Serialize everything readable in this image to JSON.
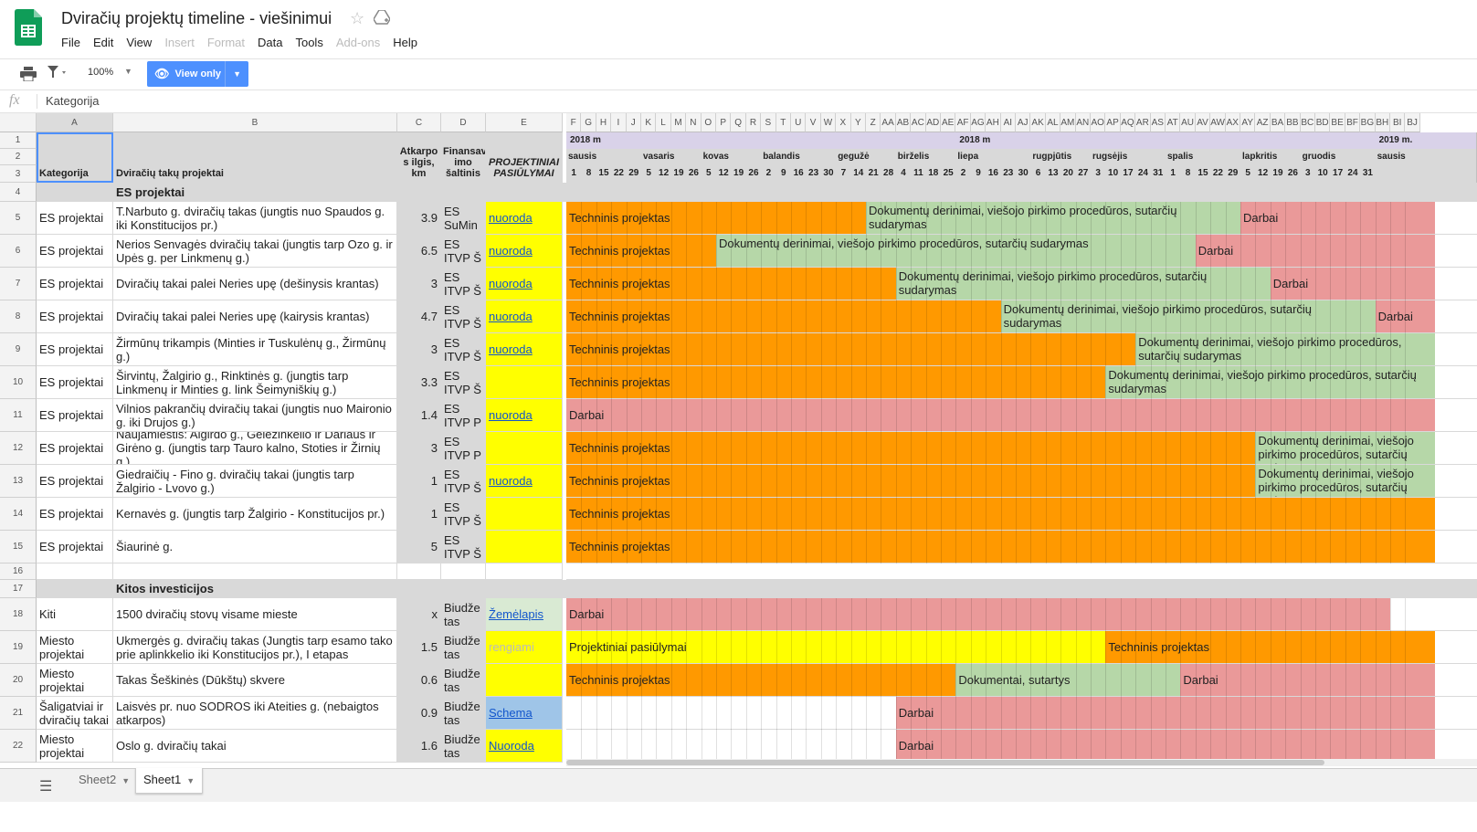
{
  "app": {
    "title": "Dviračių projektų timeline - viešinimui",
    "menu": [
      {
        "label": "File",
        "enabled": true
      },
      {
        "label": "Edit",
        "enabled": true
      },
      {
        "label": "View",
        "enabled": true
      },
      {
        "label": "Insert",
        "enabled": false
      },
      {
        "label": "Format",
        "enabled": false
      },
      {
        "label": "Data",
        "enabled": true
      },
      {
        "label": "Tools",
        "enabled": true
      },
      {
        "label": "Add-ons",
        "enabled": false
      },
      {
        "label": "Help",
        "enabled": true
      }
    ]
  },
  "toolbar": {
    "zoom": "100%",
    "view_only_label": "View only"
  },
  "formula_bar": {
    "fx": "fx",
    "content": "Kategorija"
  },
  "columns": {
    "fixed": [
      "A",
      "B",
      "C",
      "D",
      "E"
    ],
    "timeline": [
      "F",
      "G",
      "H",
      "I",
      "J",
      "K",
      "L",
      "M",
      "N",
      "O",
      "P",
      "Q",
      "R",
      "S",
      "T",
      "U",
      "V",
      "W",
      "X",
      "Y",
      "Z",
      "AA",
      "AB",
      "AC",
      "AD",
      "AE",
      "AF",
      "AG",
      "AH",
      "AI",
      "AJ",
      "AK",
      "AL",
      "AM",
      "AN",
      "AO",
      "AP",
      "AQ",
      "AR",
      "AS",
      "AT",
      "AU",
      "AV",
      "AW",
      "AX",
      "AY",
      "AZ",
      "BA",
      "BB",
      "BC",
      "BD",
      "BE",
      "BF",
      "BG",
      "BH",
      "BI",
      "BJ"
    ]
  },
  "header": {
    "kategorija": "Kategorija",
    "projektai": "Dviračių takų projektai",
    "ilgis": "Atkarpo s ilgis, km",
    "finansavimas": "Finansav imo šaltinis",
    "pasiulymai": "PROJEKTINIAI PASIŪLYMAI"
  },
  "timeline": {
    "years": [
      {
        "label": "2018 m",
        "col": 0
      },
      {
        "label": "2018 m",
        "col": 26
      },
      {
        "label": "2019 m.",
        "col": 54
      }
    ],
    "months": [
      {
        "label": "sausis",
        "col": 0
      },
      {
        "label": "vasaris",
        "col": 5
      },
      {
        "label": "kovas",
        "col": 9
      },
      {
        "label": "balandis",
        "col": 13
      },
      {
        "label": "gegužė",
        "col": 18
      },
      {
        "label": "birželis",
        "col": 22
      },
      {
        "label": "liepa",
        "col": 26
      },
      {
        "label": "rugpjūtis",
        "col": 31
      },
      {
        "label": "rugsėjis",
        "col": 35
      },
      {
        "label": "spalis",
        "col": 40
      },
      {
        "label": "lapkritis",
        "col": 45
      },
      {
        "label": "gruodis",
        "col": 49
      },
      {
        "label": "sausis",
        "col": 54
      }
    ],
    "days": [
      "1",
      "8",
      "15",
      "22",
      "29",
      "5",
      "12",
      "19",
      "26",
      "5",
      "12",
      "19",
      "26",
      "2",
      "9",
      "16",
      "23",
      "30",
      "7",
      "14",
      "21",
      "28",
      "4",
      "11",
      "18",
      "25",
      "2",
      "9",
      "16",
      "23",
      "30",
      "6",
      "13",
      "20",
      "27",
      "3",
      "10",
      "17",
      "24",
      "31",
      "1",
      "8",
      "15",
      "22",
      "29",
      "5",
      "12",
      "19",
      "26",
      "3",
      "10",
      "17",
      "24",
      "31",
      "",
      "",
      ""
    ]
  },
  "rows": [
    {
      "num": "4",
      "type": "section",
      "title": "ES projektai"
    },
    {
      "num": "5",
      "cat": "ES projektai",
      "name": "T.Narbuto g. dviračių takas (jungtis nuo Spaudos g. iki Konstitucijos pr.)",
      "len": "3.9",
      "fund": "ES SuMin",
      "link": "nuoroda",
      "link_bg": "#ffff00",
      "bars": [
        {
          "s": 0,
          "e": 19,
          "c": "orange",
          "t": "Techninis projektas"
        },
        {
          "s": 20,
          "e": 44,
          "c": "green",
          "t": "Dokumentų derinimai, viešojo pirkimo procedūros, sutarčių sudarymas"
        },
        {
          "s": 45,
          "e": 57,
          "c": "red",
          "t": "Darbai"
        }
      ]
    },
    {
      "num": "6",
      "cat": "ES projektai",
      "name": "Nerios Senvagės dviračių takai (jungtis tarp Ozo g. ir Upės g. per Linkmenų g.)",
      "len": "6.5",
      "fund": "ES ITVP Š",
      "link": "nuoroda",
      "link_bg": "#ffff00",
      "bars": [
        {
          "s": 0,
          "e": 9,
          "c": "orange",
          "t": "Techninis projektas"
        },
        {
          "s": 10,
          "e": 41,
          "c": "green",
          "t": "Dokumentų derinimai, viešojo pirkimo procedūros, sutarčių sudarymas"
        },
        {
          "s": 42,
          "e": 57,
          "c": "red",
          "t": "Darbai"
        }
      ]
    },
    {
      "num": "7",
      "cat": "ES projektai",
      "name": "Dviračių takai palei Neries upę (dešinysis krantas)",
      "len": "3",
      "fund": "ES ITVP Š",
      "link": "nuoroda",
      "link_bg": "#ffff00",
      "bars": [
        {
          "s": 0,
          "e": 21,
          "c": "orange",
          "t": "Techninis projektas"
        },
        {
          "s": 22,
          "e": 46,
          "c": "green",
          "t": "Dokumentų derinimai, viešojo pirkimo procedūros, sutarčių sudarymas"
        },
        {
          "s": 47,
          "e": 57,
          "c": "red",
          "t": "Darbai"
        }
      ]
    },
    {
      "num": "8",
      "cat": "ES projektai",
      "name": "Dviračių takai palei Neries upę (kairysis krantas)",
      "len": "4.7",
      "fund": "ES ITVP Š",
      "link": "nuoroda",
      "link_bg": "#ffff00",
      "bars": [
        {
          "s": 0,
          "e": 28,
          "c": "orange",
          "t": "Techninis projektas"
        },
        {
          "s": 29,
          "e": 53,
          "c": "green",
          "t": "Dokumentų derinimai, viešojo pirkimo procedūros, sutarčių sudarymas"
        },
        {
          "s": 54,
          "e": 57,
          "c": "red",
          "t": "Darbai"
        }
      ]
    },
    {
      "num": "9",
      "cat": "ES projektai",
      "name": "Žirmūnų trikampis (Minties ir Tuskulėnų g., Žirmūnų g.)",
      "len": "3",
      "fund": "ES ITVP Š",
      "link": "nuoroda",
      "link_bg": "#ffff00",
      "bars": [
        {
          "s": 0,
          "e": 37,
          "c": "orange",
          "t": "Techninis projektas"
        },
        {
          "s": 38,
          "e": 57,
          "c": "green",
          "t": "Dokumentų derinimai, viešojo pirkimo procedūros, sutarčių sudarymas"
        }
      ]
    },
    {
      "num": "10",
      "cat": "ES projektai",
      "name": "Širvintų, Žalgirio g., Rinktinės g. (jungtis tarp Linkmenų ir Minties g. link Šeimyniškių g.)",
      "len": "3.3",
      "fund": "ES ITVP Š",
      "link": "",
      "link_bg": "#ffff00",
      "bars": [
        {
          "s": 0,
          "e": 35,
          "c": "orange",
          "t": "Techninis projektas"
        },
        {
          "s": 36,
          "e": 57,
          "c": "green",
          "t": "Dokumentų derinimai, viešojo pirkimo procedūros, sutarčių sudarymas"
        }
      ]
    },
    {
      "num": "11",
      "cat": "ES projektai",
      "name": "Vilnios pakrančių dviračių takai (jungtis nuo Maironio g. iki Drujos g.)",
      "len": "1.4",
      "fund": "ES ITVP P",
      "link": "nuoroda",
      "link_bg": "#ffff00",
      "bars": [
        {
          "s": 0,
          "e": 57,
          "c": "red",
          "t": "Darbai"
        }
      ]
    },
    {
      "num": "12",
      "cat": "ES projektai",
      "name": "Naujamiestis: Algirdo g., Geležinkelio ir Dariaus ir Girėno g. (jungtis tarp Tauro kalno, Stoties ir Žirnių g.)",
      "len": "3",
      "fund": "ES ITVP P",
      "link": "",
      "link_bg": "#ffff00",
      "bars": [
        {
          "s": 0,
          "e": 45,
          "c": "orange",
          "t": "Techninis projektas"
        },
        {
          "s": 46,
          "e": 57,
          "c": "green",
          "t": "Dokumentų derinimai, viešojo pirkimo procedūros, sutarčių sudarymas"
        }
      ]
    },
    {
      "num": "13",
      "cat": "ES projektai",
      "name": "Giedraičių - Fino g. dviračių takai (jungtis tarp Žalgirio - Lvovo g.)",
      "len": "1",
      "fund": "ES ITVP Š",
      "link": "nuoroda",
      "link_bg": "#ffff00",
      "bars": [
        {
          "s": 0,
          "e": 45,
          "c": "orange",
          "t": "Techninis projektas"
        },
        {
          "s": 46,
          "e": 57,
          "c": "green",
          "t": "Dokumentų derinimai, viešojo pirkimo procedūros, sutarčių sudarymas"
        }
      ]
    },
    {
      "num": "14",
      "cat": "ES projektai",
      "name": "Kernavės g. (jungtis tarp Žalgirio - Konstitucijos pr.)",
      "len": "1",
      "fund": "ES ITVP Š",
      "link": "",
      "link_bg": "#ffff00",
      "bars": [
        {
          "s": 0,
          "e": 57,
          "c": "orange",
          "t": "Techninis projektas"
        }
      ]
    },
    {
      "num": "15",
      "cat": "ES projektai",
      "name": "Šiaurinė g.",
      "len": "5",
      "fund": "ES ITVP Š",
      "link": "",
      "link_bg": "#ffff00",
      "bars": [
        {
          "s": 0,
          "e": 57,
          "c": "orange",
          "t": "Techninis projektas"
        }
      ]
    },
    {
      "num": "16",
      "type": "empty"
    },
    {
      "num": "17",
      "type": "section",
      "title": "Kitos investicijos"
    },
    {
      "num": "18",
      "cat": "Kiti",
      "name": "1500 dviračių stovų visame mieste",
      "len": "x",
      "fund": "Biudže tas",
      "link": "Žemėlapis",
      "link_bg": "#d9ead3",
      "bars": [
        {
          "s": 0,
          "e": 54,
          "c": "red",
          "t": "Darbai"
        }
      ]
    },
    {
      "num": "19",
      "cat": "Miesto projektai",
      "name": "Ukmergės g. dviračių takas (Jungtis tarp esamo tako prie aplinkkelio iki Konstitucijos pr.), I etapas",
      "len": "1.5",
      "fund": "Biudže tas",
      "link": "rengiami",
      "link_bg": "#ffff00",
      "link_plain": true,
      "bars": [
        {
          "s": 0,
          "e": 35,
          "c": "yellow",
          "t": "Projektiniai pasiūlymai"
        },
        {
          "s": 36,
          "e": 57,
          "c": "orange",
          "t": "Techninis projektas"
        }
      ]
    },
    {
      "num": "20",
      "cat": "Miesto projektai",
      "name": "Takas Šeškinės (Dūkštų) skvere",
      "len": "0.6",
      "fund": "Biudže tas",
      "link": "",
      "link_bg": "#ffff00",
      "bars": [
        {
          "s": 0,
          "e": 25,
          "c": "orange",
          "t": "Techninis projektas"
        },
        {
          "s": 26,
          "e": 40,
          "c": "green",
          "t": "Dokumentai, sutartys"
        },
        {
          "s": 41,
          "e": 57,
          "c": "red",
          "t": "Darbai"
        }
      ]
    },
    {
      "num": "21",
      "cat": "Šaligatviai ir dviračių takai",
      "name": "Laisvės pr. nuo SODROS iki Ateities g. (nebaigtos atkarpos)",
      "len": "0.9",
      "fund": "Biudže tas",
      "link": "Schema",
      "link_bg": "#9fc5e8",
      "bars": [
        {
          "s": 22,
          "e": 57,
          "c": "red",
          "t": "Darbai"
        }
      ]
    },
    {
      "num": "22",
      "cat": "Miesto projektai",
      "name": "Oslo g. dviračių takai",
      "len": "1.6",
      "fund": "Biudže tas",
      "link": "Nuoroda",
      "link_bg": "#ffff00",
      "bars": [
        {
          "s": 22,
          "e": 57,
          "c": "red",
          "t": "Darbai"
        }
      ]
    }
  ],
  "sheets": {
    "tabs": [
      "Sheet2",
      "Sheet1"
    ],
    "active": "Sheet1"
  },
  "colors": {
    "orange": "#ff9900",
    "green": "#b6d7a8",
    "red": "#ea9999",
    "yellow": "#ffff00",
    "accent": "#4d90fe"
  }
}
